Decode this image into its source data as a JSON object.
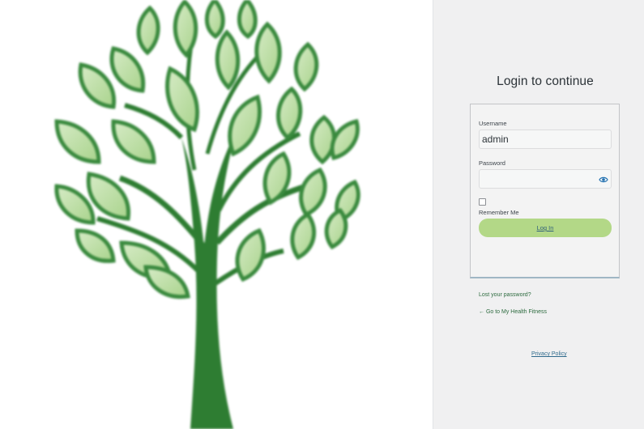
{
  "page": {
    "title": "Login to continue"
  },
  "form": {
    "username_label": "Username",
    "username_value": "admin",
    "password_label": "Password",
    "password_value": "",
    "remember_label": "Remember Me",
    "remember_checked": false,
    "login_button": "Log In"
  },
  "links": {
    "lost_password": "Lost your password?",
    "back_to_site": "← Go to My Health Fitness",
    "privacy_policy": "Privacy Policy"
  },
  "icons": {
    "password_toggle": "eye-icon",
    "hero_image": "tree-illustration"
  },
  "colors": {
    "panel_bg": "#f0f0f1",
    "button_green": "#b3d887",
    "tree_dark": "#2e7d32",
    "tree_light": "#b9dea2",
    "link_green": "#2d6b3f"
  }
}
